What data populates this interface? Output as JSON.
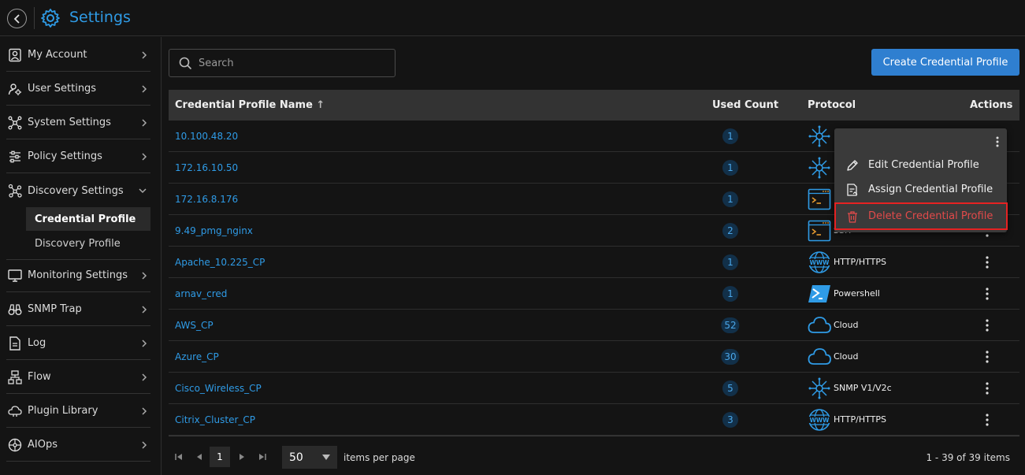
{
  "header": {
    "title": "Settings"
  },
  "sidebar": {
    "items": [
      {
        "label": "My Account"
      },
      {
        "label": "User Settings"
      },
      {
        "label": "System Settings"
      },
      {
        "label": "Policy Settings"
      },
      {
        "label": "Discovery Settings"
      },
      {
        "label": "Monitoring Settings"
      },
      {
        "label": "SNMP Trap"
      },
      {
        "label": "Log"
      },
      {
        "label": "Flow"
      },
      {
        "label": "Plugin Library"
      },
      {
        "label": "AIOps"
      }
    ],
    "sub_items": [
      {
        "label": "Credential Profile",
        "active": true
      },
      {
        "label": "Discovery Profile",
        "active": false
      }
    ]
  },
  "toolbar": {
    "search_placeholder": "Search",
    "create_label": "Create Credential Profile"
  },
  "table": {
    "columns": {
      "name": "Credential Profile Name",
      "sort_icon": "↑",
      "used_count": "Used Count",
      "protocol": "Protocol",
      "actions": "Actions"
    },
    "rows": [
      {
        "name": "10.100.48.20",
        "count": "1",
        "protocol": "",
        "icon": "snmp-icon"
      },
      {
        "name": "172.16.10.50",
        "count": "1",
        "protocol": "",
        "icon": "snmp-icon"
      },
      {
        "name": "172.16.8.176",
        "count": "1",
        "protocol": "",
        "icon": "ssh-icon"
      },
      {
        "name": "9.49_pmg_nginx",
        "count": "2",
        "protocol": "SSH",
        "icon": "ssh-icon"
      },
      {
        "name": "Apache_10.225_CP",
        "count": "1",
        "protocol": "HTTP/HTTPS",
        "icon": "www-icon"
      },
      {
        "name": "arnav_cred",
        "count": "1",
        "protocol": "Powershell",
        "icon": "powershell-icon"
      },
      {
        "name": "AWS_CP",
        "count": "52",
        "protocol": "Cloud",
        "icon": "cloud-icon"
      },
      {
        "name": "Azure_CP",
        "count": "30",
        "protocol": "Cloud",
        "icon": "cloud-icon"
      },
      {
        "name": "Cisco_Wireless_CP",
        "count": "5",
        "protocol": "SNMP V1/V2c",
        "icon": "snmp-icon"
      },
      {
        "name": "Citrix_Cluster_CP",
        "count": "3",
        "protocol": "HTTP/HTTPS",
        "icon": "www-icon"
      }
    ]
  },
  "context_menu": {
    "edit": "Edit Credential Profile",
    "assign": "Assign Credential Profile",
    "delete": "Delete Credential Profile"
  },
  "pagination": {
    "current_page": "1",
    "page_size": "50",
    "items_per_page_label": "items per page",
    "total_label": "1 - 39 of 39 items"
  },
  "colors": {
    "accent": "#2f9be6",
    "button": "#2f7fd0",
    "danger": "#e52222",
    "badge_bg": "#123049"
  }
}
